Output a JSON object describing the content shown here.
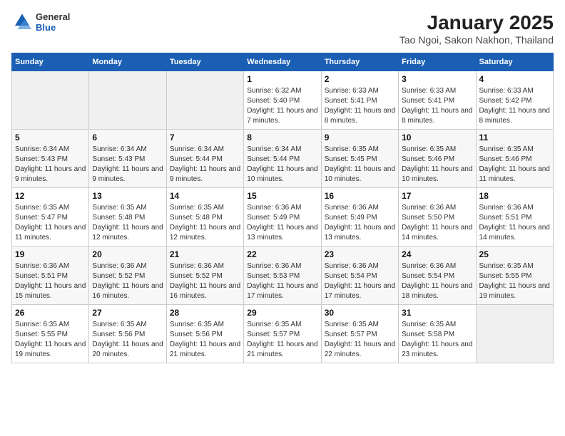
{
  "header": {
    "logo_general": "General",
    "logo_blue": "Blue",
    "title": "January 2025",
    "subtitle": "Tao Ngoi, Sakon Nakhon, Thailand"
  },
  "columns": [
    "Sunday",
    "Monday",
    "Tuesday",
    "Wednesday",
    "Thursday",
    "Friday",
    "Saturday"
  ],
  "weeks": [
    [
      {
        "day": "",
        "info": ""
      },
      {
        "day": "",
        "info": ""
      },
      {
        "day": "",
        "info": ""
      },
      {
        "day": "1",
        "info": "Sunrise: 6:32 AM\nSunset: 5:40 PM\nDaylight: 11 hours and 7 minutes."
      },
      {
        "day": "2",
        "info": "Sunrise: 6:33 AM\nSunset: 5:41 PM\nDaylight: 11 hours and 8 minutes."
      },
      {
        "day": "3",
        "info": "Sunrise: 6:33 AM\nSunset: 5:41 PM\nDaylight: 11 hours and 8 minutes."
      },
      {
        "day": "4",
        "info": "Sunrise: 6:33 AM\nSunset: 5:42 PM\nDaylight: 11 hours and 8 minutes."
      }
    ],
    [
      {
        "day": "5",
        "info": "Sunrise: 6:34 AM\nSunset: 5:43 PM\nDaylight: 11 hours and 9 minutes."
      },
      {
        "day": "6",
        "info": "Sunrise: 6:34 AM\nSunset: 5:43 PM\nDaylight: 11 hours and 9 minutes."
      },
      {
        "day": "7",
        "info": "Sunrise: 6:34 AM\nSunset: 5:44 PM\nDaylight: 11 hours and 9 minutes."
      },
      {
        "day": "8",
        "info": "Sunrise: 6:34 AM\nSunset: 5:44 PM\nDaylight: 11 hours and 10 minutes."
      },
      {
        "day": "9",
        "info": "Sunrise: 6:35 AM\nSunset: 5:45 PM\nDaylight: 11 hours and 10 minutes."
      },
      {
        "day": "10",
        "info": "Sunrise: 6:35 AM\nSunset: 5:46 PM\nDaylight: 11 hours and 10 minutes."
      },
      {
        "day": "11",
        "info": "Sunrise: 6:35 AM\nSunset: 5:46 PM\nDaylight: 11 hours and 11 minutes."
      }
    ],
    [
      {
        "day": "12",
        "info": "Sunrise: 6:35 AM\nSunset: 5:47 PM\nDaylight: 11 hours and 11 minutes."
      },
      {
        "day": "13",
        "info": "Sunrise: 6:35 AM\nSunset: 5:48 PM\nDaylight: 11 hours and 12 minutes."
      },
      {
        "day": "14",
        "info": "Sunrise: 6:35 AM\nSunset: 5:48 PM\nDaylight: 11 hours and 12 minutes."
      },
      {
        "day": "15",
        "info": "Sunrise: 6:36 AM\nSunset: 5:49 PM\nDaylight: 11 hours and 13 minutes."
      },
      {
        "day": "16",
        "info": "Sunrise: 6:36 AM\nSunset: 5:49 PM\nDaylight: 11 hours and 13 minutes."
      },
      {
        "day": "17",
        "info": "Sunrise: 6:36 AM\nSunset: 5:50 PM\nDaylight: 11 hours and 14 minutes."
      },
      {
        "day": "18",
        "info": "Sunrise: 6:36 AM\nSunset: 5:51 PM\nDaylight: 11 hours and 14 minutes."
      }
    ],
    [
      {
        "day": "19",
        "info": "Sunrise: 6:36 AM\nSunset: 5:51 PM\nDaylight: 11 hours and 15 minutes."
      },
      {
        "day": "20",
        "info": "Sunrise: 6:36 AM\nSunset: 5:52 PM\nDaylight: 11 hours and 16 minutes."
      },
      {
        "day": "21",
        "info": "Sunrise: 6:36 AM\nSunset: 5:52 PM\nDaylight: 11 hours and 16 minutes."
      },
      {
        "day": "22",
        "info": "Sunrise: 6:36 AM\nSunset: 5:53 PM\nDaylight: 11 hours and 17 minutes."
      },
      {
        "day": "23",
        "info": "Sunrise: 6:36 AM\nSunset: 5:54 PM\nDaylight: 11 hours and 17 minutes."
      },
      {
        "day": "24",
        "info": "Sunrise: 6:36 AM\nSunset: 5:54 PM\nDaylight: 11 hours and 18 minutes."
      },
      {
        "day": "25",
        "info": "Sunrise: 6:35 AM\nSunset: 5:55 PM\nDaylight: 11 hours and 19 minutes."
      }
    ],
    [
      {
        "day": "26",
        "info": "Sunrise: 6:35 AM\nSunset: 5:55 PM\nDaylight: 11 hours and 19 minutes."
      },
      {
        "day": "27",
        "info": "Sunrise: 6:35 AM\nSunset: 5:56 PM\nDaylight: 11 hours and 20 minutes."
      },
      {
        "day": "28",
        "info": "Sunrise: 6:35 AM\nSunset: 5:56 PM\nDaylight: 11 hours and 21 minutes."
      },
      {
        "day": "29",
        "info": "Sunrise: 6:35 AM\nSunset: 5:57 PM\nDaylight: 11 hours and 21 minutes."
      },
      {
        "day": "30",
        "info": "Sunrise: 6:35 AM\nSunset: 5:57 PM\nDaylight: 11 hours and 22 minutes."
      },
      {
        "day": "31",
        "info": "Sunrise: 6:35 AM\nSunset: 5:58 PM\nDaylight: 11 hours and 23 minutes."
      },
      {
        "day": "",
        "info": ""
      }
    ]
  ]
}
